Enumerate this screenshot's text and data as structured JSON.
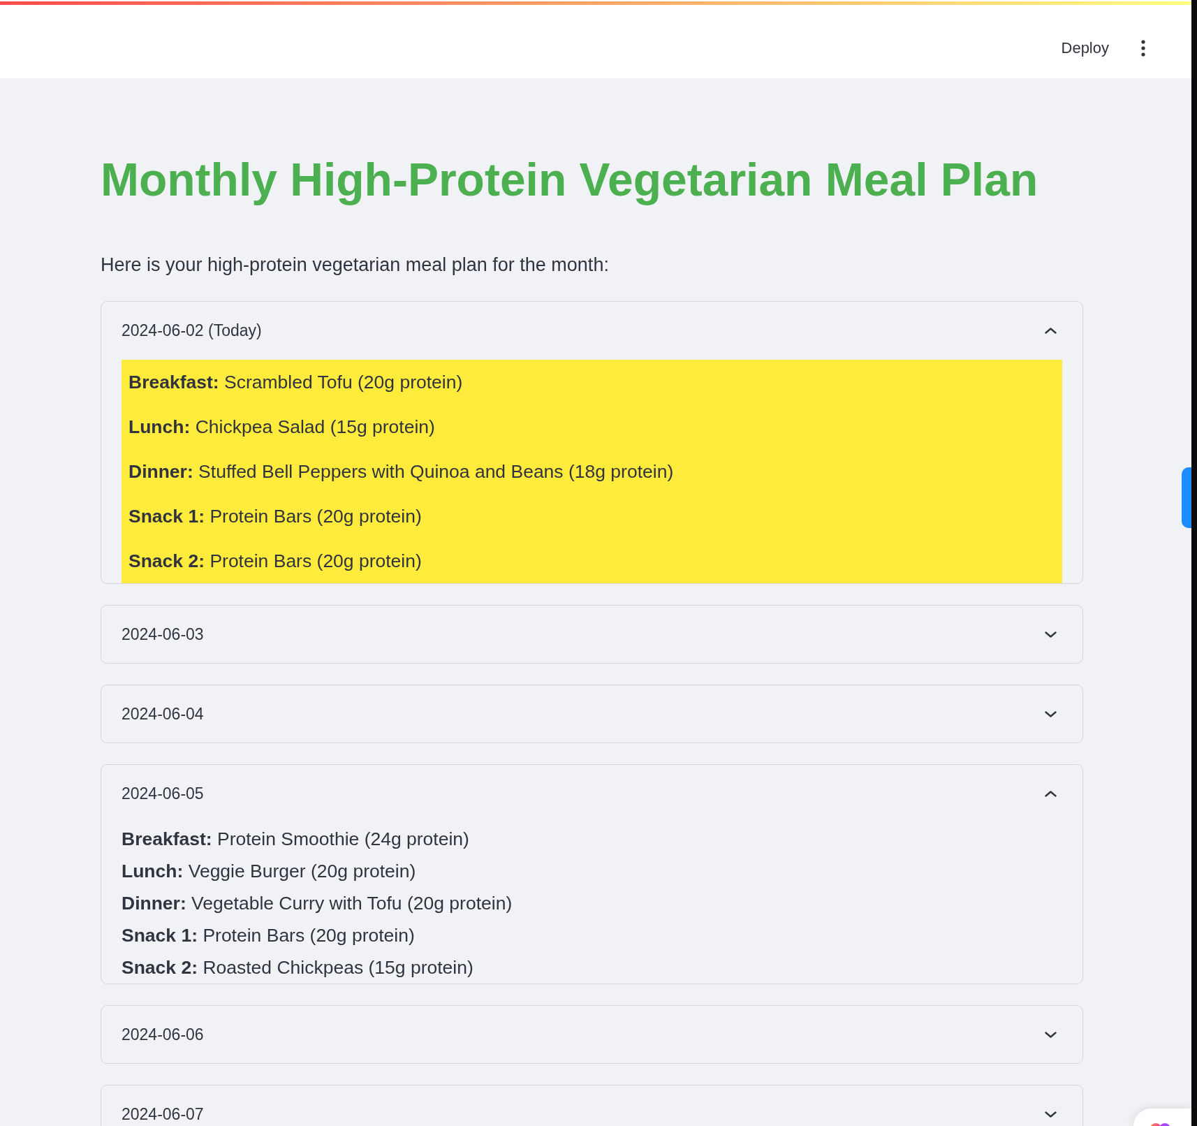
{
  "header": {
    "deploy_label": "Deploy"
  },
  "title": "Monthly High-Protein Vegetarian Meal Plan",
  "intro": "Here is your high-protein vegetarian meal plan for the month:",
  "days": [
    {
      "label": "2024-06-02 (Today)",
      "expanded": true,
      "highlighted": true,
      "meals": [
        "**Breakfast:** Scrambled Tofu (20g protein)",
        "**Lunch:** Chickpea Salad (15g protein)",
        "**Dinner:** Stuffed Bell Peppers with Quinoa and Beans (18g protein)",
        "**Snack 1:** Protein Bars (20g protein)",
        "**Snack 2:** Protein Bars (20g protein)"
      ]
    },
    {
      "label": "2024-06-03",
      "expanded": false
    },
    {
      "label": "2024-06-04",
      "expanded": false
    },
    {
      "label": "2024-06-05",
      "expanded": true,
      "highlighted": false,
      "meals": [
        "**Breakfast:** Protein Smoothie (24g protein)",
        "**Lunch:** Veggie Burger (20g protein)",
        "**Dinner:** Vegetable Curry with Tofu (20g protein)",
        "**Snack 1:** Protein Bars (20g protein)",
        "**Snack 2:** Roasted Chickpeas (15g protein)"
      ]
    },
    {
      "label": "2024-06-06",
      "expanded": false
    },
    {
      "label": "2024-06-07",
      "expanded": false
    }
  ]
}
